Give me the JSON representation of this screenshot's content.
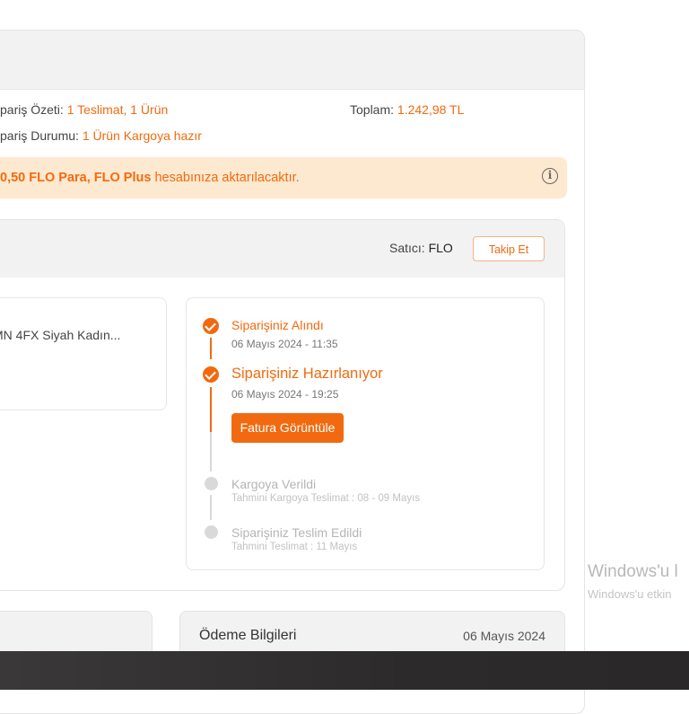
{
  "summary": {
    "order_summary_label": "pariş Özeti:",
    "order_summary_value": "1 Teslimat, 1 Ürün",
    "order_status_label": "pariş Durumu:",
    "order_status_value": "1 Ürün Kargoya hazır",
    "total_label": "Toplam:",
    "total_value": "1.242,98 TL"
  },
  "notice": {
    "bold_text": "0,50 FLO Para, FLO Plus",
    "rest_text": " hesabınıza aktarılacaktır.",
    "icon": "info-icon"
  },
  "shipment": {
    "seller_label": "Satıcı: ",
    "seller_name": "FLO",
    "follow_label": "Takip Et",
    "product_name": "MN 4FX Siyah Kadın..."
  },
  "timeline": {
    "steps": [
      {
        "title": "Siparişiniz Alındı",
        "subtitle": "06 Mayıs 2024 - 11:35",
        "status": "done"
      },
      {
        "title": "Siparişiniz Hazırlanıyor",
        "subtitle": "06 Mayıs 2024 - 19:25",
        "status": "done"
      },
      {
        "title": "Kargoya Verildi",
        "subtitle": "Tahmini Kargoya Teslimat : 08 - 09 Mayıs",
        "status": "pending"
      },
      {
        "title": "Siparişiniz Teslim Edildi",
        "subtitle": "Tahmini Teslimat : 11 Mayıs",
        "status": "pending"
      }
    ],
    "invoice_button": "Fatura Görüntüle"
  },
  "payment": {
    "title": "Ödeme Bilgileri",
    "date": "06 Mayıs 2024"
  },
  "watermark": {
    "line1": "Windows'u l",
    "line2": "Windows'u etkin"
  },
  "colors": {
    "accent": "#f26a10",
    "notice_bg": "#fde9cf",
    "header_bg": "#f2f2f2"
  }
}
